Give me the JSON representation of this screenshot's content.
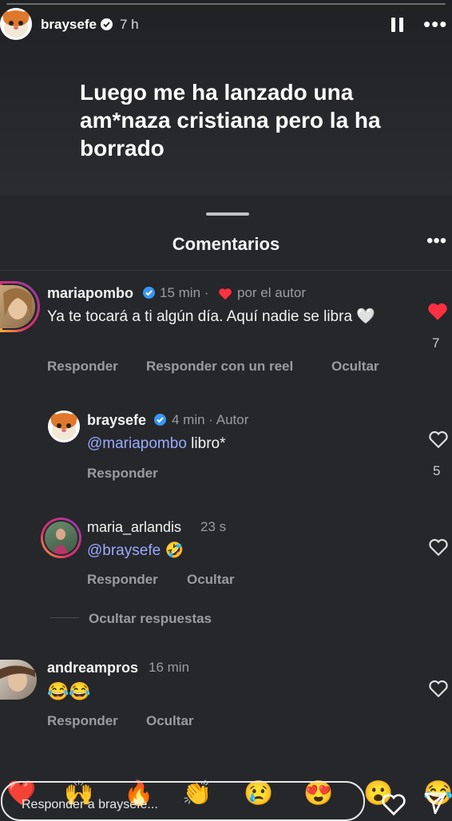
{
  "story": {
    "username": "braysefe",
    "time": "7 h",
    "text": "Luego me ha lanzado una am*naza cristiana pero la ha borrado"
  },
  "sheet": {
    "title": "Comentarios"
  },
  "comments": [
    {
      "username": "mariapombo",
      "time": "15 min",
      "liked_by_author": "por el autor",
      "text": "Ya te tocará a ti algún día. Aquí nadie se libra 🤍",
      "likes": "7",
      "actions": [
        "Responder",
        "Responder con un reel",
        "Ocultar"
      ]
    },
    {
      "username": "braysefe",
      "time": "4 min",
      "badge": "Autor",
      "mention": "@mariapombo",
      "text": " libro*",
      "likes": "5",
      "actions": [
        "Responder"
      ]
    },
    {
      "username": "maria_arlandis",
      "time": "23 s",
      "mention": "@braysefe",
      "text": " 🤣",
      "actions": [
        "Responder",
        "Ocultar"
      ]
    },
    {
      "username": "andreampros",
      "time": "16 min",
      "text": "😂😂",
      "actions": [
        "Responder",
        "Ocultar"
      ]
    }
  ],
  "hide_replies": "Ocultar respuestas",
  "reply_bar": {
    "placeholder": "Responder a braysefe...",
    "reactions": [
      "❤️",
      "🙌",
      "🔥",
      "👏",
      "😢",
      "😍",
      "😮",
      "😂"
    ]
  },
  "colors": {
    "background": "#25272b",
    "liked_heart": "#ff3040",
    "mention": "#9aa9ff",
    "verified": "#3897f0"
  }
}
